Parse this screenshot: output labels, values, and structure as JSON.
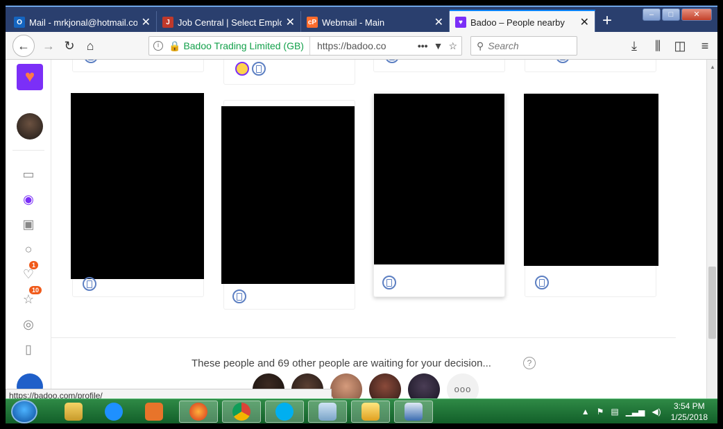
{
  "tabs": [
    {
      "title": "Mail - mrkjonal@hotmail.co",
      "icon": "outlook-icon",
      "color": "#1565c0",
      "active": false
    },
    {
      "title": "Job Central | Select Employer",
      "icon": "job-central-icon",
      "color": "#c0392b",
      "active": false
    },
    {
      "title": "Webmail - Main",
      "icon": "cpanel-icon",
      "color": "#ff6c2c",
      "active": false
    },
    {
      "title": "Badoo – People nearby",
      "icon": "badoo-heart-icon",
      "color": "#7b2ff7",
      "active": true
    }
  ],
  "nav": {
    "site_identity": "Badoo Trading Limited (GB)",
    "url": "https://badoo.co",
    "search_placeholder": "Search"
  },
  "sidebar": {
    "notifications": [
      {
        "icon": "heart-icon",
        "count": "1"
      },
      {
        "icon": "star-icon",
        "count": "10"
      }
    ]
  },
  "waiting": {
    "text": "These people and 69 other people are waiting for your decision...",
    "help": "?",
    "more": "ooo"
  },
  "status_bar": "https://badoo.com/profile/",
  "clock": {
    "time": "3:54 PM",
    "date": "1/25/2018"
  },
  "colors": {
    "accent": "#7b2ff7",
    "badge": "#f05a1a",
    "mobile_icon": "#5c7fc2"
  }
}
